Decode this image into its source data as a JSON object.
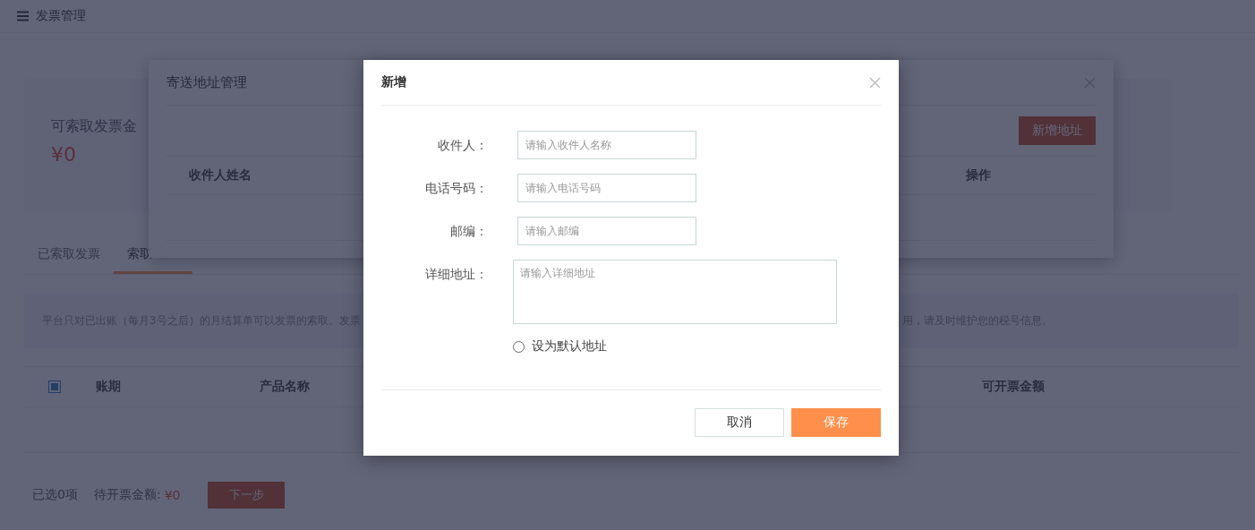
{
  "header": {
    "title": "发票管理"
  },
  "summary": {
    "label": "可索取发票金",
    "amount": "¥0"
  },
  "tabs": [
    {
      "label": "已索取发票",
      "selected": false
    },
    {
      "label": "索取",
      "selected": true
    }
  ],
  "notice": {
    "start": "平台只对已出账（每月3号之后）的月结算单可以发票的索取。发票",
    "end": "用，请及时维护您的税号信息。"
  },
  "table": {
    "select_all": {
      "indeterminate": true
    },
    "columns": [
      "账期",
      "产品名称",
      "可开票金额"
    ]
  },
  "footer": {
    "selected_count": "已选0项",
    "pending_label": "待开票金额:",
    "pending_amount": "¥0",
    "next_button": {
      "label": "下一步",
      "disabled": true
    }
  },
  "address_dialog": {
    "title": "寄送地址管理",
    "add_button": "新增地址",
    "columns": [
      "收件人姓名",
      "操作"
    ]
  },
  "new_dialog": {
    "title": "新增",
    "fields": [
      {
        "kind": "input",
        "label": "收件人：",
        "placeholder": "请输入收件人名称"
      },
      {
        "kind": "input",
        "label": "电话号码：",
        "placeholder": "请输入电话号码"
      },
      {
        "kind": "input",
        "label": "邮编：",
        "placeholder": "请输入邮编"
      },
      {
        "kind": "textarea",
        "label": "详细地址：",
        "placeholder": "请输入详细地址"
      }
    ],
    "default_option": {
      "label": "设为默认地址",
      "selected": false
    },
    "buttons": [
      {
        "kind": "secondary",
        "label": "取消"
      },
      {
        "kind": "primary",
        "label": "保存"
      }
    ]
  }
}
